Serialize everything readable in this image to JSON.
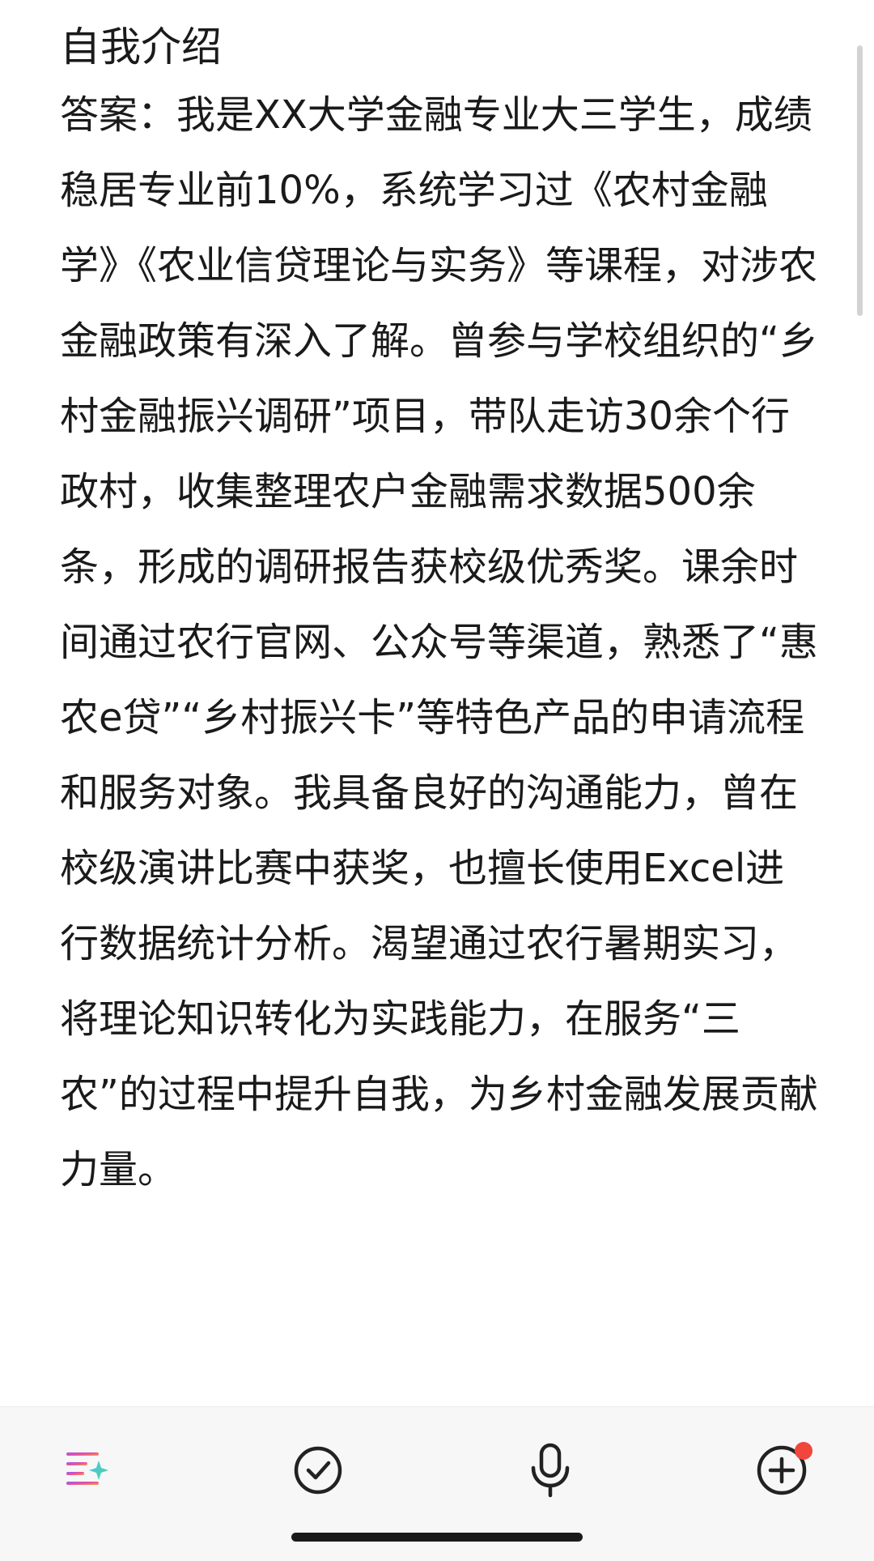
{
  "note": {
    "title": "自我介绍",
    "body": "答案：我是XX大学金融专业大三学生，成绩稳居专业前10%，系统学习过《农村金融学》《农业信贷理论与实务》等课程，对涉农金融政策有深入了解。曾参与学校组织的“乡村金融振兴调研”项目，带队走访30余个行政村，收集整理农户金融需求数据500余条，形成的调研报告获校级优秀奖。课余时间通过农行官网、公众号等渠道，熟悉了“惠农e贷”“乡村振兴卡”等特色产品的申请流程和服务对象。我具备良好的沟通能力，曾在校级演讲比赛中获奖，也擅长使用Excel进行数据统计分析。渴望通过农行暑期实习，将理论知识转化为实践能力，在服务“三农”的过程中提升自我，为乡村金融发展贡献力量。"
  },
  "toolbar": {
    "items": [
      {
        "icon": "ai-format-icon"
      },
      {
        "icon": "checklist-icon"
      },
      {
        "icon": "microphone-icon"
      },
      {
        "icon": "add-icon",
        "has_badge": true
      }
    ]
  },
  "colors": {
    "text": "#1a1a1a",
    "toolbar_bg": "#f7f7f8",
    "badge": "#f0463c",
    "icon_stroke": "#222222"
  }
}
